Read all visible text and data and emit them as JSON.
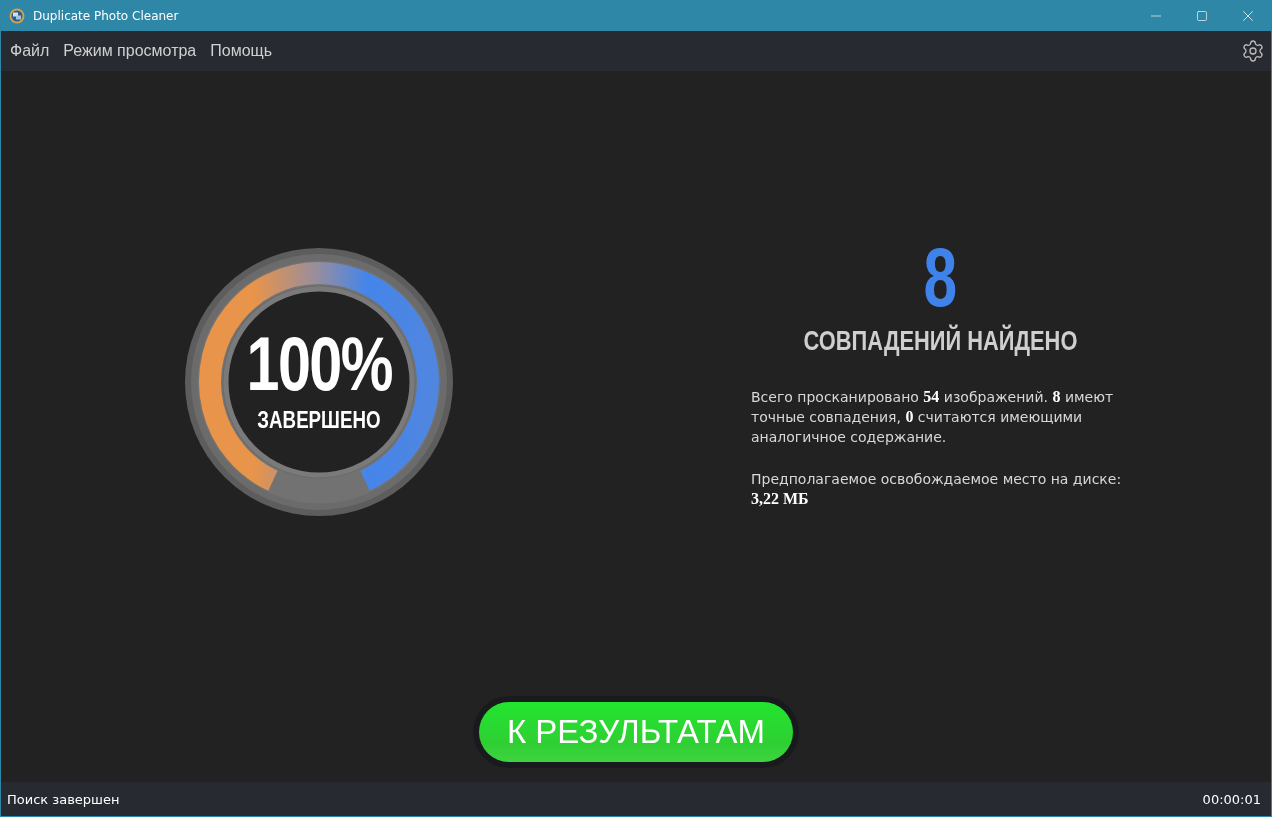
{
  "window": {
    "title": "Duplicate Photo Cleaner"
  },
  "menu": [
    "Файл",
    "Режим просмотра",
    "Помощь"
  ],
  "gauge": {
    "percent": "100%",
    "caption": "ЗАВЕРШЕНО",
    "level": 1
  },
  "summary": {
    "count": "8",
    "heading": "СОВПАДЕНИЙ НАЙДЕНО",
    "details": "Всего просканировано **54** изображений. **8** имеют точные совпадения, **0** считаются имеющими аналогичное содержание.",
    "space_label": "Предполагаемое освобождаемое место на диске:",
    "space_value": "3,22 МБ"
  },
  "action_button": "К РЕЗУЛЬТАТАМ",
  "status_bar": {
    "message": "Поиск завершен",
    "elapsed": "00:00:01"
  }
}
